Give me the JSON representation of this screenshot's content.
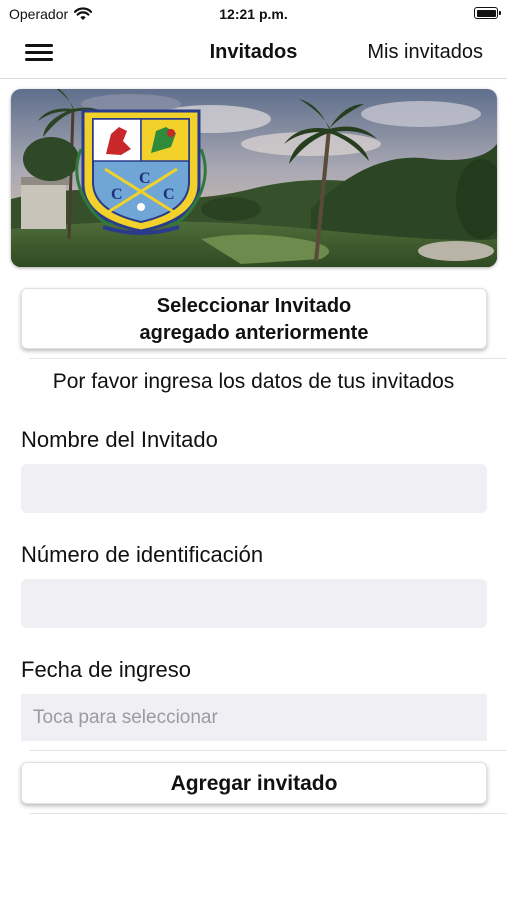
{
  "status_bar": {
    "carrier": "Operador",
    "time": "12:21 p.m."
  },
  "nav": {
    "title": "Invitados",
    "right_button": "Mis invitados",
    "menu_icon": "hamburger-menu-icon"
  },
  "hero": {
    "description_icon": "club-crest-logo",
    "crest_letters": [
      "C",
      "C",
      "C"
    ]
  },
  "select_button": {
    "line1": "Seleccionar Invitado",
    "line2": "agregado anteriormente"
  },
  "intro_text": "Por favor ingresa los datos de tus invitados",
  "form": {
    "name": {
      "label": "Nombre del Invitado",
      "value": "",
      "placeholder": ""
    },
    "id_number": {
      "label": "Número de identificación",
      "value": "",
      "placeholder": ""
    },
    "date": {
      "label": "Fecha de ingreso",
      "placeholder": "Toca para seleccionar"
    }
  },
  "add_button": "Agregar invitado",
  "colors": {
    "field_background": "#efeff4",
    "placeholder_text": "#9a9aa0",
    "crest_yellow": "#f2d22a",
    "crest_red": "#c8282a",
    "crest_blue": "#6fa6d6"
  }
}
